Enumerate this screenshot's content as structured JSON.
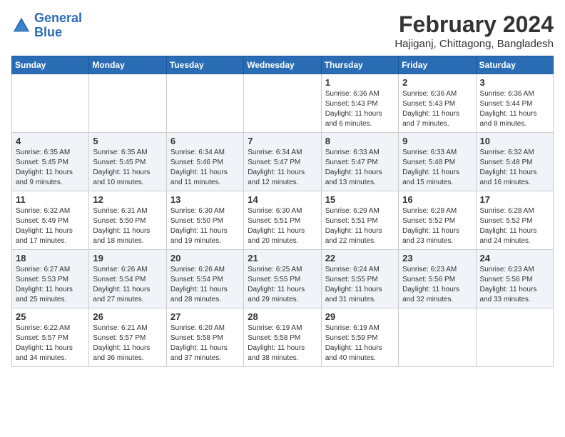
{
  "header": {
    "logo_line1": "General",
    "logo_line2": "Blue",
    "month_title": "February 2024",
    "location": "Hajiganj, Chittagong, Bangladesh"
  },
  "weekdays": [
    "Sunday",
    "Monday",
    "Tuesday",
    "Wednesday",
    "Thursday",
    "Friday",
    "Saturday"
  ],
  "weeks": [
    [
      {
        "day": "",
        "sunrise": "",
        "sunset": "",
        "daylight": ""
      },
      {
        "day": "",
        "sunrise": "",
        "sunset": "",
        "daylight": ""
      },
      {
        "day": "",
        "sunrise": "",
        "sunset": "",
        "daylight": ""
      },
      {
        "day": "",
        "sunrise": "",
        "sunset": "",
        "daylight": ""
      },
      {
        "day": "1",
        "sunrise": "Sunrise: 6:36 AM",
        "sunset": "Sunset: 5:43 PM",
        "daylight": "Daylight: 11 hours and 6 minutes."
      },
      {
        "day": "2",
        "sunrise": "Sunrise: 6:36 AM",
        "sunset": "Sunset: 5:43 PM",
        "daylight": "Daylight: 11 hours and 7 minutes."
      },
      {
        "day": "3",
        "sunrise": "Sunrise: 6:36 AM",
        "sunset": "Sunset: 5:44 PM",
        "daylight": "Daylight: 11 hours and 8 minutes."
      }
    ],
    [
      {
        "day": "4",
        "sunrise": "Sunrise: 6:35 AM",
        "sunset": "Sunset: 5:45 PM",
        "daylight": "Daylight: 11 hours and 9 minutes."
      },
      {
        "day": "5",
        "sunrise": "Sunrise: 6:35 AM",
        "sunset": "Sunset: 5:45 PM",
        "daylight": "Daylight: 11 hours and 10 minutes."
      },
      {
        "day": "6",
        "sunrise": "Sunrise: 6:34 AM",
        "sunset": "Sunset: 5:46 PM",
        "daylight": "Daylight: 11 hours and 11 minutes."
      },
      {
        "day": "7",
        "sunrise": "Sunrise: 6:34 AM",
        "sunset": "Sunset: 5:47 PM",
        "daylight": "Daylight: 11 hours and 12 minutes."
      },
      {
        "day": "8",
        "sunrise": "Sunrise: 6:33 AM",
        "sunset": "Sunset: 5:47 PM",
        "daylight": "Daylight: 11 hours and 13 minutes."
      },
      {
        "day": "9",
        "sunrise": "Sunrise: 6:33 AM",
        "sunset": "Sunset: 5:48 PM",
        "daylight": "Daylight: 11 hours and 15 minutes."
      },
      {
        "day": "10",
        "sunrise": "Sunrise: 6:32 AM",
        "sunset": "Sunset: 5:48 PM",
        "daylight": "Daylight: 11 hours and 16 minutes."
      }
    ],
    [
      {
        "day": "11",
        "sunrise": "Sunrise: 6:32 AM",
        "sunset": "Sunset: 5:49 PM",
        "daylight": "Daylight: 11 hours and 17 minutes."
      },
      {
        "day": "12",
        "sunrise": "Sunrise: 6:31 AM",
        "sunset": "Sunset: 5:50 PM",
        "daylight": "Daylight: 11 hours and 18 minutes."
      },
      {
        "day": "13",
        "sunrise": "Sunrise: 6:30 AM",
        "sunset": "Sunset: 5:50 PM",
        "daylight": "Daylight: 11 hours and 19 minutes."
      },
      {
        "day": "14",
        "sunrise": "Sunrise: 6:30 AM",
        "sunset": "Sunset: 5:51 PM",
        "daylight": "Daylight: 11 hours and 20 minutes."
      },
      {
        "day": "15",
        "sunrise": "Sunrise: 6:29 AM",
        "sunset": "Sunset: 5:51 PM",
        "daylight": "Daylight: 11 hours and 22 minutes."
      },
      {
        "day": "16",
        "sunrise": "Sunrise: 6:28 AM",
        "sunset": "Sunset: 5:52 PM",
        "daylight": "Daylight: 11 hours and 23 minutes."
      },
      {
        "day": "17",
        "sunrise": "Sunrise: 6:28 AM",
        "sunset": "Sunset: 5:52 PM",
        "daylight": "Daylight: 11 hours and 24 minutes."
      }
    ],
    [
      {
        "day": "18",
        "sunrise": "Sunrise: 6:27 AM",
        "sunset": "Sunset: 5:53 PM",
        "daylight": "Daylight: 11 hours and 25 minutes."
      },
      {
        "day": "19",
        "sunrise": "Sunrise: 6:26 AM",
        "sunset": "Sunset: 5:54 PM",
        "daylight": "Daylight: 11 hours and 27 minutes."
      },
      {
        "day": "20",
        "sunrise": "Sunrise: 6:26 AM",
        "sunset": "Sunset: 5:54 PM",
        "daylight": "Daylight: 11 hours and 28 minutes."
      },
      {
        "day": "21",
        "sunrise": "Sunrise: 6:25 AM",
        "sunset": "Sunset: 5:55 PM",
        "daylight": "Daylight: 11 hours and 29 minutes."
      },
      {
        "day": "22",
        "sunrise": "Sunrise: 6:24 AM",
        "sunset": "Sunset: 5:55 PM",
        "daylight": "Daylight: 11 hours and 31 minutes."
      },
      {
        "day": "23",
        "sunrise": "Sunrise: 6:23 AM",
        "sunset": "Sunset: 5:56 PM",
        "daylight": "Daylight: 11 hours and 32 minutes."
      },
      {
        "day": "24",
        "sunrise": "Sunrise: 6:23 AM",
        "sunset": "Sunset: 5:56 PM",
        "daylight": "Daylight: 11 hours and 33 minutes."
      }
    ],
    [
      {
        "day": "25",
        "sunrise": "Sunrise: 6:22 AM",
        "sunset": "Sunset: 5:57 PM",
        "daylight": "Daylight: 11 hours and 34 minutes."
      },
      {
        "day": "26",
        "sunrise": "Sunrise: 6:21 AM",
        "sunset": "Sunset: 5:57 PM",
        "daylight": "Daylight: 11 hours and 36 minutes."
      },
      {
        "day": "27",
        "sunrise": "Sunrise: 6:20 AM",
        "sunset": "Sunset: 5:58 PM",
        "daylight": "Daylight: 11 hours and 37 minutes."
      },
      {
        "day": "28",
        "sunrise": "Sunrise: 6:19 AM",
        "sunset": "Sunset: 5:58 PM",
        "daylight": "Daylight: 11 hours and 38 minutes."
      },
      {
        "day": "29",
        "sunrise": "Sunrise: 6:19 AM",
        "sunset": "Sunset: 5:59 PM",
        "daylight": "Daylight: 11 hours and 40 minutes."
      },
      {
        "day": "",
        "sunrise": "",
        "sunset": "",
        "daylight": ""
      },
      {
        "day": "",
        "sunrise": "",
        "sunset": "",
        "daylight": ""
      }
    ]
  ]
}
